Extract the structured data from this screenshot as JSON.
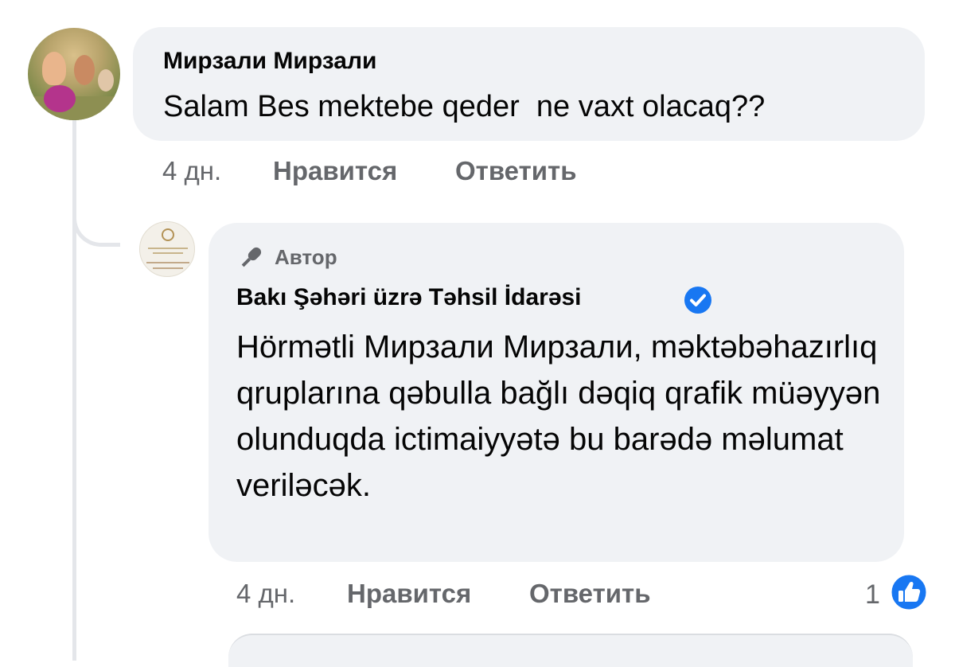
{
  "comments": [
    {
      "author": "Мирзали Мирзали",
      "text": "Salam Bes mektebe qeder  ne vaxt olacaq??",
      "time": "4 дн.",
      "like_label": "Нравится",
      "reply_label": "Ответить"
    },
    {
      "badge": "Автор",
      "author": "Bakı Şəhəri üzrə Təhsil İdarəsi",
      "text": "Hörmətli Мирзали Мирзали, məktəbəhazırlıq qruplarına qəbulla bağlı dəqiq qrafik müəyyən olunduqda ictimaiyyətə bu barədə məlumat veriləcək.",
      "time": "4 дн.",
      "like_label": "Нравится",
      "reply_label": "Ответить",
      "reaction_count": "1"
    }
  ],
  "colors": {
    "bubble": "#f0f2f5",
    "secondary_text": "#65676b",
    "verified_blue": "#1877f2",
    "thread_line": "#e4e6ea"
  },
  "icons": {
    "badge": "microphone-icon",
    "verified": "verified-check-icon",
    "reaction": "like-thumb-icon"
  }
}
